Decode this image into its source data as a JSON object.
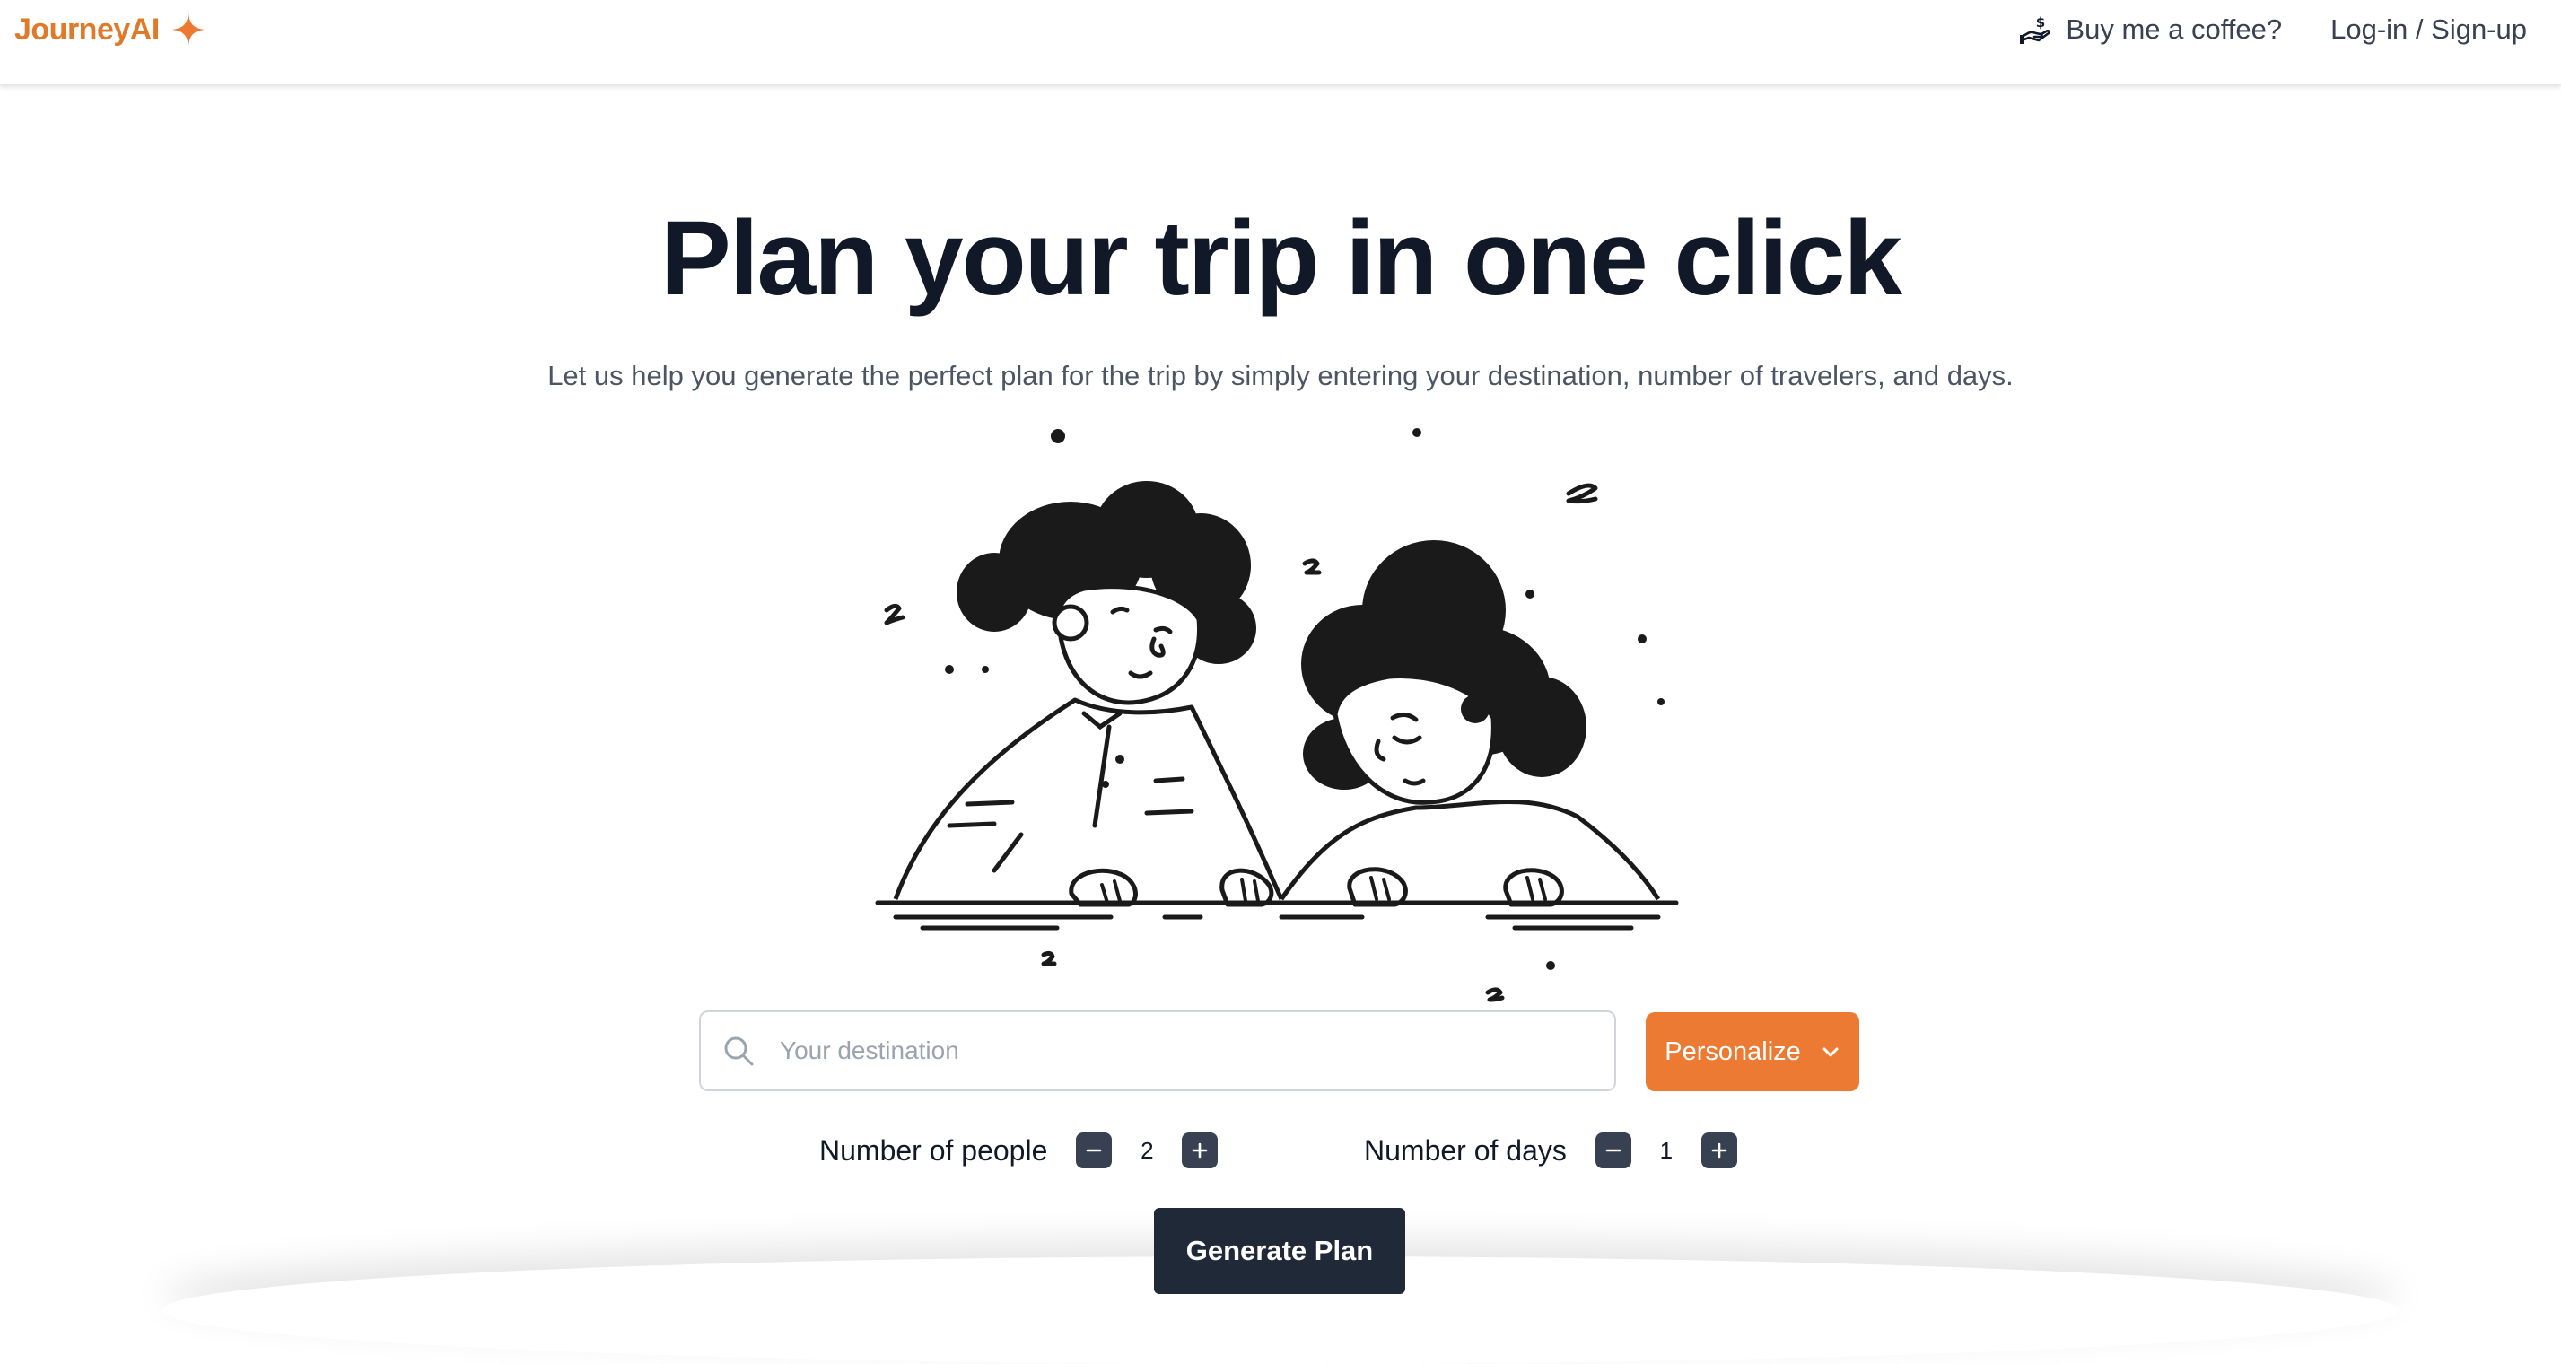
{
  "brand": {
    "name": "JourneyAI",
    "accent_color": "#ec7a33",
    "logo_icon": "sparkle-icon"
  },
  "nav": {
    "coffee_label": "Buy me a coffee?",
    "coffee_icon": "hand-coin-icon",
    "login_label": "Log-in / Sign-up"
  },
  "hero": {
    "title": "Plan your trip in one click",
    "subtitle": "Let us help you generate the perfect plan for the trip by simply entering your destination, number of travelers, and days.",
    "illustration": "two-people-sleeping-at-desk"
  },
  "search": {
    "placeholder": "Your destination",
    "value": "",
    "icon": "search-icon"
  },
  "personalize": {
    "label": "Personalize",
    "icon": "chevron-down-icon"
  },
  "people": {
    "label": "Number of people",
    "value": "2"
  },
  "days": {
    "label": "Number of days",
    "value": "1"
  },
  "generate": {
    "label": "Generate Plan"
  }
}
